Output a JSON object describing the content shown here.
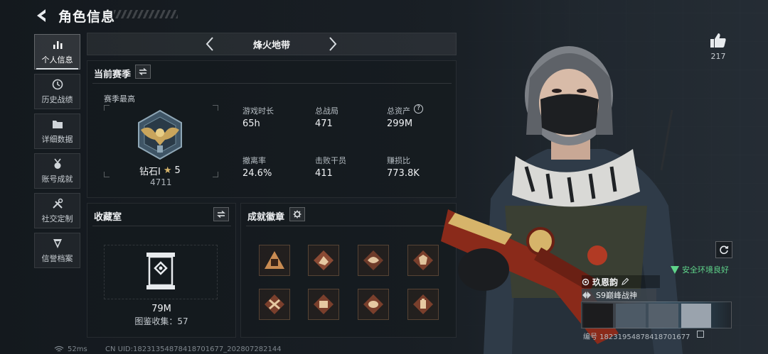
{
  "header": {
    "title": "角色信息"
  },
  "nav": {
    "items": [
      {
        "label": "个人信息",
        "icon": "bar-chart-icon",
        "active": true
      },
      {
        "label": "历史战绩",
        "icon": "history-icon",
        "active": false
      },
      {
        "label": "详细数据",
        "icon": "folder-icon",
        "active": false
      },
      {
        "label": "账号成就",
        "icon": "medal-icon",
        "active": false
      },
      {
        "label": "社交定制",
        "icon": "tools-icon",
        "active": false
      },
      {
        "label": "信誉档案",
        "icon": "shield-icon",
        "active": false
      }
    ]
  },
  "season": {
    "name": "烽火地带"
  },
  "current_season": {
    "title": "当前赛季",
    "best_label": "赛季最高",
    "rank_name": "钻石Ⅰ",
    "rank_stars": "5",
    "rank_score": "4711",
    "stats": [
      {
        "label": "游戏时长",
        "value": "65h"
      },
      {
        "label": "总战局",
        "value": "471"
      },
      {
        "label": "总资产",
        "value": "299M",
        "help": "?"
      },
      {
        "label": "撤离率",
        "value": "24.6%"
      },
      {
        "label": "击败干员",
        "value": "411"
      },
      {
        "label": "赚损比",
        "value": "773.8K"
      }
    ]
  },
  "collection": {
    "title": "收藏室",
    "value": "79M",
    "count_text": "图鉴收集：57"
  },
  "achievements": {
    "title": "成就徽章",
    "badges": [
      "badge-1-icon",
      "badge-2-icon",
      "badge-3-icon",
      "badge-4-icon",
      "badge-5-icon",
      "badge-6-icon",
      "badge-7-icon",
      "badge-8-icon"
    ]
  },
  "character": {
    "likes": "217",
    "safety_text": "安全环境良好",
    "player_name": "玖恩韵",
    "title_badge": "S9巅峰战神",
    "player_id": "编号 18231954878418701677"
  },
  "footer": {
    "ping": "52ms",
    "uid": "CN UID:18231354878418701677_202807282144"
  },
  "colors": {
    "accent_green": "#5fd48a",
    "badge_brown": "#8a5a3c",
    "gold": "#d6b46a"
  }
}
